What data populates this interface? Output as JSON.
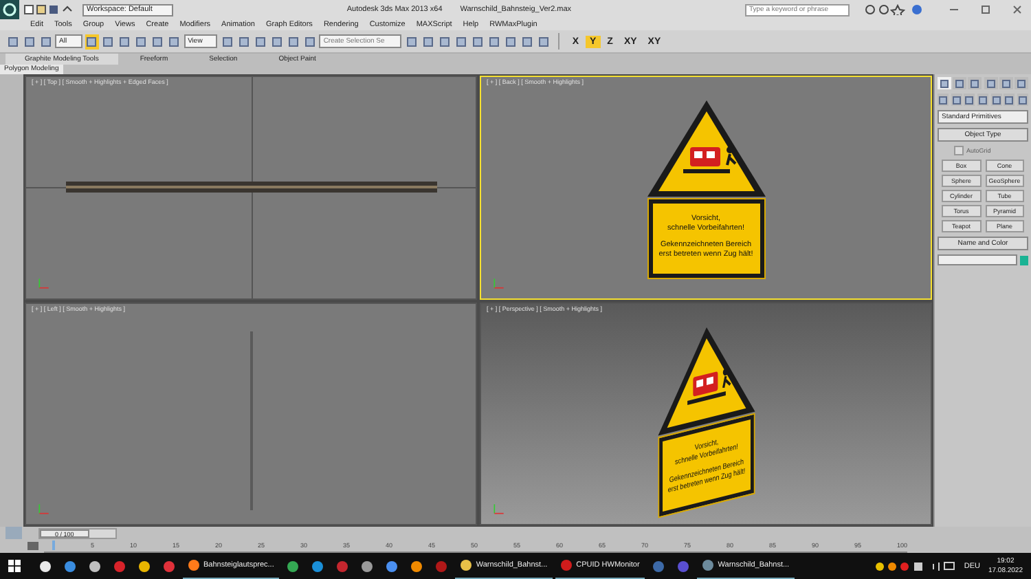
{
  "window": {
    "title": "Autodesk 3ds Max  2013 x64",
    "file": "Warnschild_Bahnsteig_Ver2.max",
    "workspace": "Workspace: Default",
    "search_placeholder": "Type a keyword or phrase"
  },
  "menu": [
    "Edit",
    "Tools",
    "Group",
    "Views",
    "Create",
    "Modifiers",
    "Animation",
    "Graph Editors",
    "Rendering",
    "Customize",
    "MAXScript",
    "Help",
    "RWMaxPlugin"
  ],
  "toolbar": {
    "selection_filter": "All",
    "reference_coord": "View",
    "named_selection_placeholder": "Create Selection Se",
    "axes": [
      {
        "label": "X",
        "selected": false
      },
      {
        "label": "Y",
        "selected": true
      },
      {
        "label": "Z",
        "selected": false
      },
      {
        "label": "XY",
        "selected": false
      },
      {
        "label": "XY",
        "selected": false
      }
    ]
  },
  "ribbon": {
    "tabs": [
      {
        "label": "Graphite Modeling Tools",
        "selected": true
      },
      {
        "label": "Freeform",
        "selected": false
      },
      {
        "label": "Selection",
        "selected": false
      },
      {
        "label": "Object Paint",
        "selected": false
      }
    ],
    "panel": "Polygon Modeling"
  },
  "viewports": [
    {
      "label": "[ + ] [ Top ] [ Smooth + Highlights + Edged Faces ]",
      "kind": "top",
      "active": false
    },
    {
      "label": "[ + ] [ Back ] [ Smooth + Highlights ]",
      "kind": "back",
      "active": true
    },
    {
      "label": "[ + ] [ Left ] [ Smooth + Highlights ]",
      "kind": "left",
      "active": false
    },
    {
      "label": "[ + ] [ Perspective ] [ Smooth + Highlights ]",
      "kind": "perspective",
      "active": false
    }
  ],
  "sign_back": {
    "heading": [
      "Vorsicht,",
      "schnelle Vorbeifahrten!"
    ],
    "body": [
      "Gekennzeichneten Bereich",
      "erst betreten wenn Zug hält!"
    ]
  },
  "sign_perspective": {
    "heading": [
      "Vorsicht,",
      "schnelle Vorbeifahrten!"
    ],
    "body": [
      "Gekennzeichneten Bereich",
      "erst betreten wenn Zug hält!"
    ]
  },
  "command_panel": {
    "tabs": [
      {
        "selected": true
      },
      {
        "selected": false
      },
      {
        "selected": false
      },
      {
        "selected": false
      },
      {
        "selected": false
      },
      {
        "selected": false
      }
    ],
    "dropdown": "Standard Primitives",
    "object_type": "Object Type",
    "autogrid": {
      "label": "AutoGrid",
      "checked": false,
      "disabled": true
    },
    "buttons": [
      "Box",
      "Cone",
      "Sphere",
      "GeoSphere",
      "Cylinder",
      "Tube",
      "Torus",
      "Pyramid",
      "Teapot",
      "Plane"
    ],
    "name_and_color": "Name and Color"
  },
  "timeline": {
    "frame": "0 / 100",
    "level": 0,
    "ticks": [
      "5",
      "10",
      "15",
      "20",
      "25",
      "30",
      "35",
      "40",
      "45",
      "50",
      "55",
      "60",
      "65",
      "70",
      "75",
      "80",
      "85",
      "90",
      "95",
      "100"
    ]
  },
  "taskbar": {
    "items": [
      {
        "kind": "icon",
        "color": "#e8e8e8"
      },
      {
        "kind": "icon",
        "color": "#3a8de0"
      },
      {
        "kind": "icon",
        "color": "#c0c0c0"
      },
      {
        "kind": "icon",
        "color": "#d8232a"
      },
      {
        "kind": "icon",
        "color": "#e8b400"
      },
      {
        "kind": "icon",
        "color": "#e0313a"
      },
      {
        "kind": "app",
        "color": "#ff7a1a",
        "label": "Bahnsteiglautsprec..."
      },
      {
        "kind": "icon",
        "color": "#34a853"
      },
      {
        "kind": "icon",
        "color": "#1a8fd8"
      },
      {
        "kind": "icon",
        "color": "#c4262e"
      },
      {
        "kind": "icon",
        "color": "#9a9a9a"
      },
      {
        "kind": "icon",
        "color": "#4a8ff0"
      },
      {
        "kind": "icon",
        "color": "#f08a00"
      },
      {
        "kind": "icon",
        "color": "#b01818"
      },
      {
        "kind": "app",
        "color": "#e8c048",
        "label": "Warnschild_Bahnst..."
      },
      {
        "kind": "app",
        "color": "#d01c1c",
        "label": "CPUID HWMonitor"
      },
      {
        "kind": "icon",
        "color": "#3d6aa8"
      },
      {
        "kind": "icon",
        "color": "#5a4fd0"
      },
      {
        "kind": "app",
        "color": "#6c8a9c",
        "label": "Warnschild_Bahnst..."
      }
    ],
    "language": "DEU",
    "time": "19:02",
    "date": "17.08.2022"
  }
}
